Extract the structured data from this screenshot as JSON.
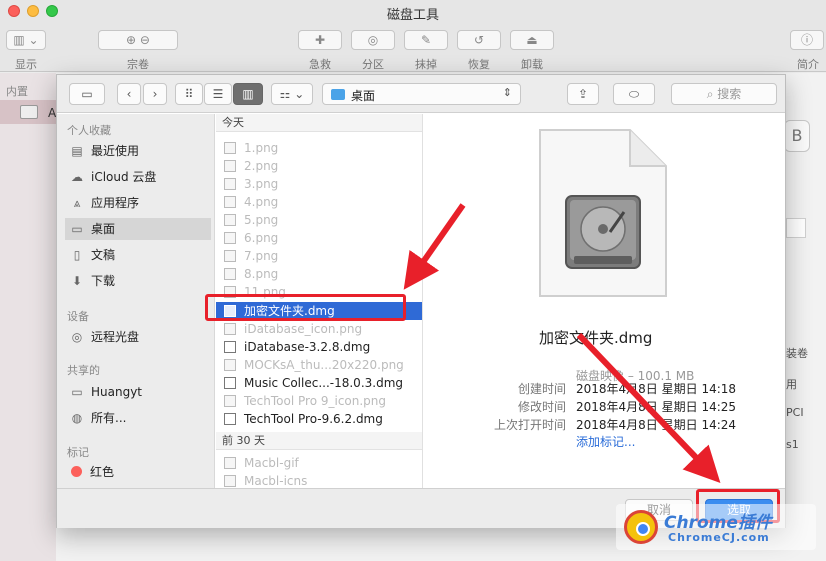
{
  "app": {
    "title": "磁盘工具"
  },
  "toolbar": {
    "items": [
      {
        "label": "显示",
        "icon": "sidebar-toggle-icon"
      },
      {
        "label": "宗卷",
        "icon": "volume-icon"
      },
      {
        "label": "急救",
        "icon": "first-aid-icon"
      },
      {
        "label": "分区",
        "icon": "partition-icon"
      },
      {
        "label": "抹掉",
        "icon": "erase-icon"
      },
      {
        "label": "恢复",
        "icon": "restore-icon"
      },
      {
        "label": "卸载",
        "icon": "eject-icon"
      },
      {
        "label": "简介",
        "icon": "info-icon"
      }
    ]
  },
  "app_sidebar": {
    "section": "内置",
    "selected_prefix": "A"
  },
  "right_peek": {
    "b": "B",
    "items": [
      "装卷",
      "用",
      "PCI",
      "s1"
    ]
  },
  "panel": {
    "location": "桌面",
    "search_placeholder": "搜索",
    "sidebar": {
      "favorites_head": "个人收藏",
      "favorites": [
        {
          "label": "最近使用",
          "icon": "recents-icon"
        },
        {
          "label": "iCloud 云盘",
          "icon": "cloud-icon"
        },
        {
          "label": "应用程序",
          "icon": "applications-icon"
        },
        {
          "label": "桌面",
          "icon": "desktop-icon",
          "selected": true
        },
        {
          "label": "文稿",
          "icon": "documents-icon"
        },
        {
          "label": "下载",
          "icon": "downloads-icon"
        }
      ],
      "devices_head": "设备",
      "devices": [
        {
          "label": "远程光盘",
          "icon": "remote-disc-icon"
        }
      ],
      "shared_head": "共享的",
      "shared": [
        {
          "label": "Huangyt",
          "icon": "computer-icon"
        },
        {
          "label": "所有...",
          "icon": "network-icon"
        }
      ],
      "tags_head": "标记",
      "tags": [
        {
          "label": "红色",
          "color": "#fc605b"
        }
      ]
    },
    "files": {
      "today_head": "今天",
      "today": [
        {
          "name": "1.png",
          "enabled": false
        },
        {
          "name": "2.png",
          "enabled": false
        },
        {
          "name": "3.png",
          "enabled": false
        },
        {
          "name": "4.png",
          "enabled": false
        },
        {
          "name": "5.png",
          "enabled": false
        },
        {
          "name": "6.png",
          "enabled": false
        },
        {
          "name": "7.png",
          "enabled": false
        },
        {
          "name": "8.png",
          "enabled": false
        },
        {
          "name": "11.png",
          "enabled": false
        },
        {
          "name": "加密文件夹.dmg",
          "enabled": true,
          "selected": true
        },
        {
          "name": "iDatabase_icon.png",
          "enabled": false
        },
        {
          "name": "iDatabase-3.2.8.dmg",
          "enabled": true
        },
        {
          "name": "MOCKsA_thu...20x220.png",
          "enabled": false
        },
        {
          "name": "Music Collec...-18.0.3.dmg",
          "enabled": true
        },
        {
          "name": "TechTool Pro 9_icon.png",
          "enabled": false
        },
        {
          "name": "TechTool Pro-9.6.2.dmg",
          "enabled": true
        }
      ],
      "earlier_head": "前 30 天",
      "earlier": [
        {
          "name": "Macbl-gif",
          "enabled": false
        },
        {
          "name": "Macbl-icns",
          "enabled": false
        }
      ]
    },
    "preview": {
      "name": "加密文件夹.dmg",
      "kind": "磁盘映像 – 100.1 MB",
      "created_label": "创建时间",
      "created": "2018年4月8日 星期日 14:18",
      "modified_label": "修改时间",
      "modified": "2018年4月8日 星期日 14:25",
      "opened_label": "上次打开时间",
      "opened": "2018年4月8日 星期日 14:24",
      "add_tags": "添加标记..."
    },
    "cancel": "取消",
    "choose": "选取"
  },
  "watermark": {
    "title": "Chrome插件",
    "url": "ChromeCJ.com"
  },
  "colors": {
    "accent": "#2f6ad6",
    "highlight": "#e8202a",
    "primary_button": "#3b8df0"
  }
}
